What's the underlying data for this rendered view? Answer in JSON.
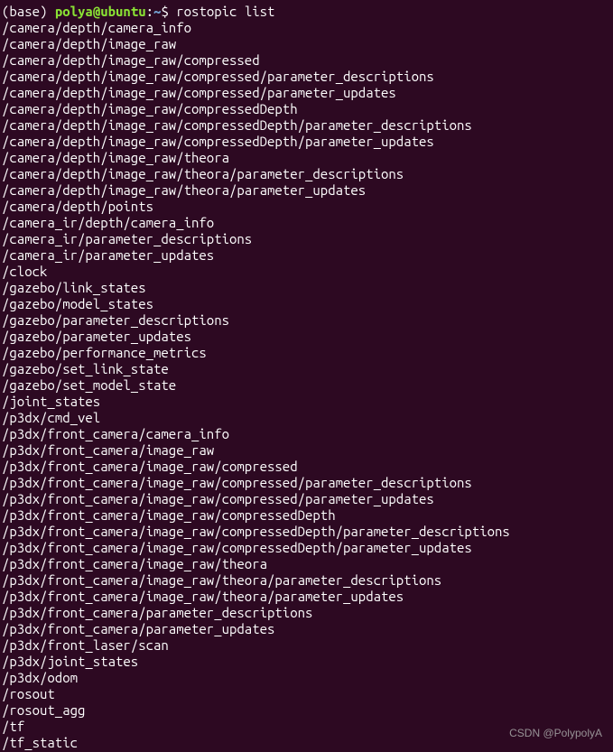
{
  "prompt": {
    "env": "(base) ",
    "user_host": "polya@ubuntu",
    "colon": ":",
    "path": "~",
    "dollar": "$ "
  },
  "command": "rostopic list",
  "output": [
    "/camera/depth/camera_info",
    "/camera/depth/image_raw",
    "/camera/depth/image_raw/compressed",
    "/camera/depth/image_raw/compressed/parameter_descriptions",
    "/camera/depth/image_raw/compressed/parameter_updates",
    "/camera/depth/image_raw/compressedDepth",
    "/camera/depth/image_raw/compressedDepth/parameter_descriptions",
    "/camera/depth/image_raw/compressedDepth/parameter_updates",
    "/camera/depth/image_raw/theora",
    "/camera/depth/image_raw/theora/parameter_descriptions",
    "/camera/depth/image_raw/theora/parameter_updates",
    "/camera/depth/points",
    "/camera_ir/depth/camera_info",
    "/camera_ir/parameter_descriptions",
    "/camera_ir/parameter_updates",
    "/clock",
    "/gazebo/link_states",
    "/gazebo/model_states",
    "/gazebo/parameter_descriptions",
    "/gazebo/parameter_updates",
    "/gazebo/performance_metrics",
    "/gazebo/set_link_state",
    "/gazebo/set_model_state",
    "/joint_states",
    "/p3dx/cmd_vel",
    "/p3dx/front_camera/camera_info",
    "/p3dx/front_camera/image_raw",
    "/p3dx/front_camera/image_raw/compressed",
    "/p3dx/front_camera/image_raw/compressed/parameter_descriptions",
    "/p3dx/front_camera/image_raw/compressed/parameter_updates",
    "/p3dx/front_camera/image_raw/compressedDepth",
    "/p3dx/front_camera/image_raw/compressedDepth/parameter_descriptions",
    "/p3dx/front_camera/image_raw/compressedDepth/parameter_updates",
    "/p3dx/front_camera/image_raw/theora",
    "/p3dx/front_camera/image_raw/theora/parameter_descriptions",
    "/p3dx/front_camera/image_raw/theora/parameter_updates",
    "/p3dx/front_camera/parameter_descriptions",
    "/p3dx/front_camera/parameter_updates",
    "/p3dx/front_laser/scan",
    "/p3dx/joint_states",
    "/p3dx/odom",
    "/rosout",
    "/rosout_agg",
    "/tf",
    "/tf_static"
  ],
  "watermark": "CSDN @PolypolyA"
}
